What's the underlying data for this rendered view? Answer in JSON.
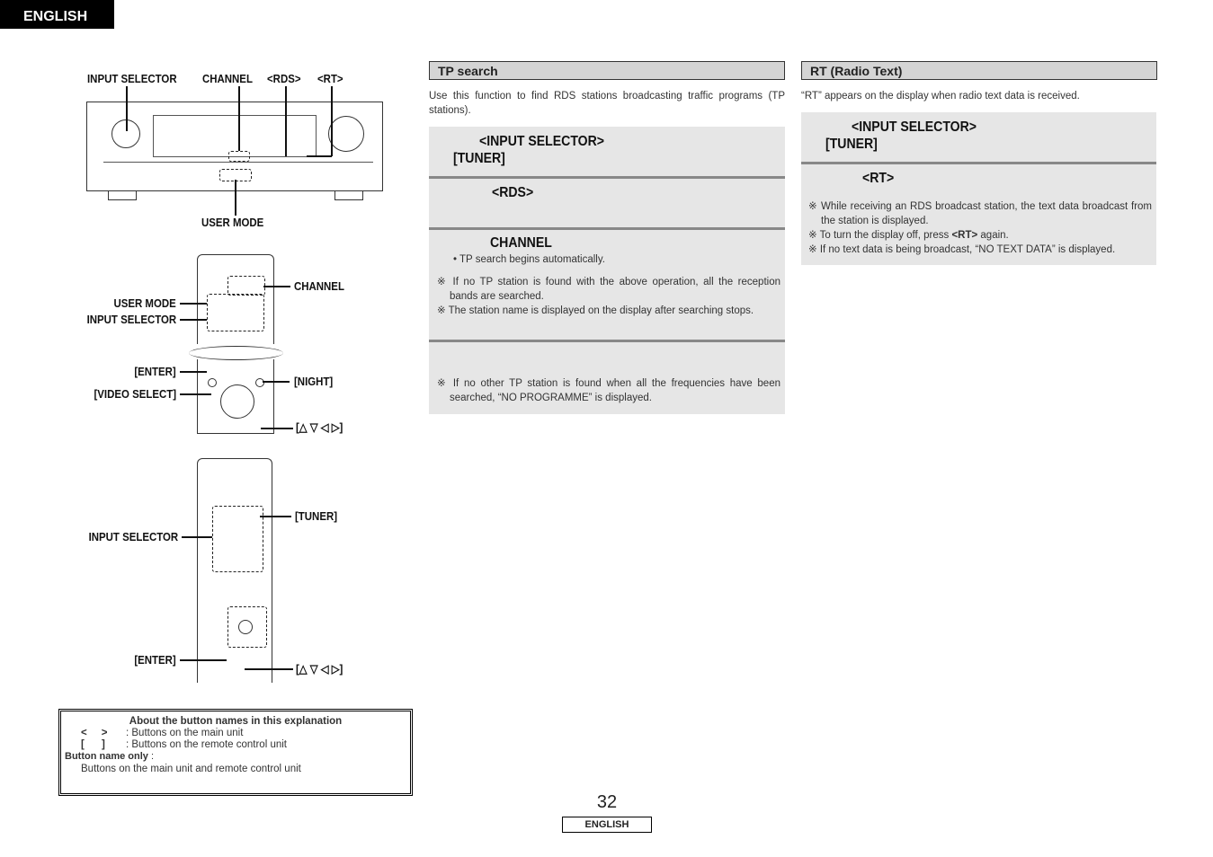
{
  "language_tag": "ENGLISH",
  "figures": {
    "receiver_labels": {
      "input_selector": "INPUT SELECTOR",
      "channel": "CHANNEL",
      "rds": "<RDS>",
      "rt": "<RT>",
      "user_mode": "USER MODE"
    },
    "remote1_labels": {
      "channel": "CHANNEL",
      "user_mode": "USER MODE",
      "input_selector": "INPUT SELECTOR",
      "enter": "[ENTER]",
      "video_select": "[VIDEO SELECT]",
      "night": "[NIGHT]",
      "cursor": "[△ ▽ ◁ ▷]"
    },
    "remote2_labels": {
      "tuner": "[TUNER]",
      "input_selector": "INPUT SELECTOR",
      "enter": "[ENTER]",
      "cursor": "[△ ▽ ◁ ▷]"
    }
  },
  "legend": {
    "title": "About the button names in this explanation",
    "main_symbol": "<     >",
    "main_text": ": Buttons on the main unit",
    "remote_symbol": "[      ]",
    "remote_text": ": Buttons on the remote control unit",
    "name_only_label": "Button name only",
    "name_only_colon": " :",
    "name_only_text": "Buttons on the main unit and remote control unit"
  },
  "tp": {
    "title": "TP search",
    "intro": "Use this function to find RDS stations broadcasting traffic programs (TP stations).",
    "step1_a": "<INPUT SELECTOR>",
    "step1_b": "[TUNER]",
    "step2": "<RDS>",
    "step3": "CHANNEL",
    "step3_bullet": "• TP search begins automatically.",
    "note1": "※ If no TP station is found with the above operation, all the reception bands are searched.",
    "note2": "※ The station name is displayed on the display after searching stops.",
    "note3": "※ If no other TP station is found when all the frequencies have been searched, “NO PROGRAMME” is displayed."
  },
  "rt": {
    "title": "RT (Radio Text)",
    "intro": "“RT” appears on the display when radio text data is received.",
    "step1_a": "<INPUT SELECTOR>",
    "step1_b": "[TUNER]",
    "step2": "<RT>",
    "note1": "※ While receiving an RDS broadcast station, the text data broadcast from the station is displayed.",
    "note2_pre": "※ To turn the display off, press ",
    "note2_btn": "<RT>",
    "note2_post": " again.",
    "note3": "※ If no text data is being broadcast, “NO TEXT DATA” is displayed."
  },
  "footer": {
    "page_number": "32",
    "language": "ENGLISH"
  }
}
